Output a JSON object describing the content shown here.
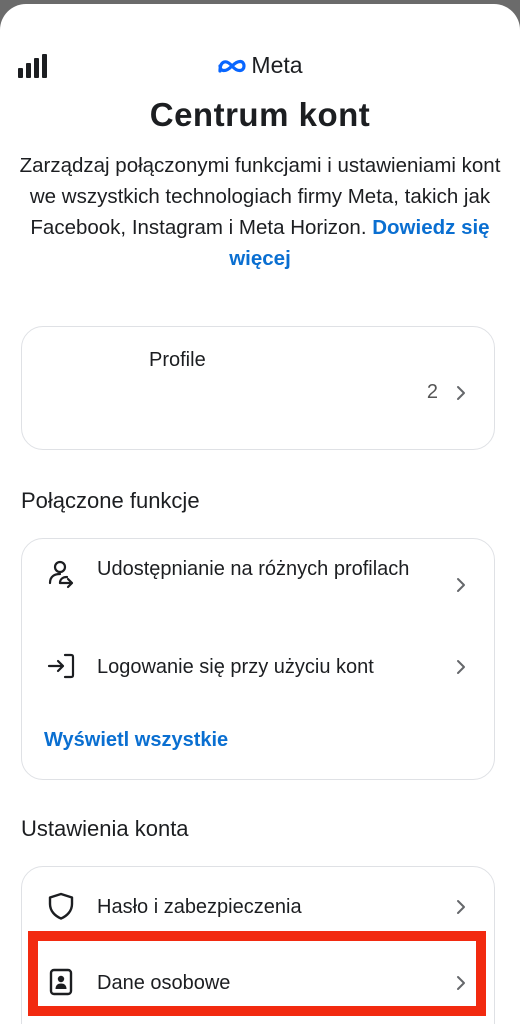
{
  "header": {
    "brand": "Meta",
    "title": "Centrum kont",
    "description": "Zarządzaj połączonymi funkcjami i ustawieniami kont we wszystkich technologiach firmy Meta, takich jak Facebook, Instagram i Meta Horizon.",
    "learn_more": "Dowiedz się więcej"
  },
  "profiles": {
    "label": "Profile",
    "count": "2"
  },
  "connected_features": {
    "title": "Połączone funkcje",
    "items": [
      {
        "label": "Udostępnianie na różnych profilach",
        "icon": "profile-share-icon"
      },
      {
        "label": "Logowanie się przy użyciu kont",
        "icon": "login-arrow-icon"
      }
    ],
    "show_all": "Wyświetl wszystkie"
  },
  "account_settings": {
    "title": "Ustawienia konta",
    "items": [
      {
        "label": "Hasło i zabezpieczenia",
        "icon": "shield-icon"
      },
      {
        "label": "Dane osobowe",
        "icon": "id-card-icon"
      }
    ]
  },
  "colors": {
    "link": "#0a6fd1",
    "highlight": "#f22a10",
    "card_border": "#dfe1e5"
  }
}
